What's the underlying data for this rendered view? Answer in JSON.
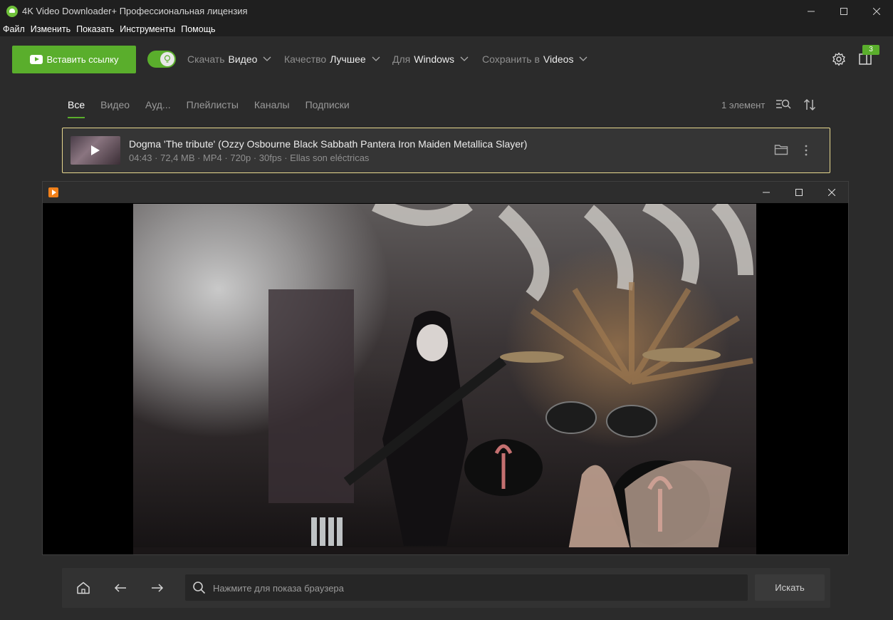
{
  "window": {
    "title": "4K Video Downloader+ Профессиональная лицензия"
  },
  "menu": {
    "items": [
      "Файл",
      "Изменить",
      "Показать",
      "Инструменты",
      "Помощь"
    ]
  },
  "toolbar": {
    "paste_label": "Вставить ссылку",
    "download": {
      "label": "Скачать",
      "value": "Видео"
    },
    "quality": {
      "label": "Качество",
      "value": "Лучшее"
    },
    "platform": {
      "label": "Для",
      "value": "Windows"
    },
    "save": {
      "label": "Сохранить в",
      "value": "Videos"
    },
    "badge_count": "3",
    "smart_mode_on": true
  },
  "tabs": [
    {
      "label": "Все",
      "active": true
    },
    {
      "label": "Видео",
      "active": false
    },
    {
      "label": "Ауд...",
      "active": false
    },
    {
      "label": "Плейлисты",
      "active": false
    },
    {
      "label": "Каналы",
      "active": false
    },
    {
      "label": "Подписки",
      "active": false
    }
  ],
  "list": {
    "count": "1 элемент",
    "items": [
      {
        "title": "Dogma 'The tribute' (Ozzy Osbourne   Black Sabbath   Pantera   Iron Maiden   Metallica   Slayer)",
        "meta": "04:43 · 72,4 MB · MP4 · 720p · 30fps · Ellas son eléctricas"
      }
    ]
  },
  "bottom": {
    "search_placeholder": "Нажмите для показа браузера",
    "search_button": "Искать"
  },
  "colors": {
    "accent": "#5aae2c",
    "selected_border": "#e8d98e",
    "player_icon": "#f0801a"
  }
}
